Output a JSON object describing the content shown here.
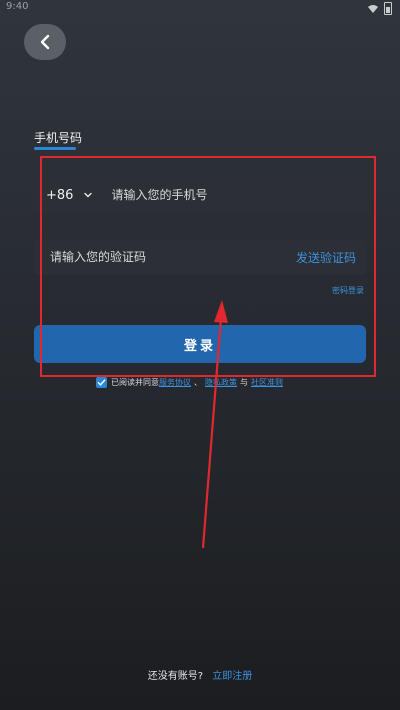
{
  "status_bar": {
    "time": "9:40",
    "icons": [
      "wifi-icon",
      "battery-icon"
    ]
  },
  "header": {
    "back_icon": "chevron-left-icon"
  },
  "login_tab": {
    "label": "手机号码"
  },
  "form": {
    "country_code": "+86",
    "phone_placeholder": "请输入您的手机号",
    "code_placeholder": "请输入您的验证码",
    "send_code_label": "发送验证码",
    "password_login_label": "密码登录",
    "login_button_label": "登录"
  },
  "agreement": {
    "checked": true,
    "prefix": "已阅读并同意",
    "terms_label": "服务协议",
    "separator": "、",
    "privacy_label": "隐私政策",
    "conjunction": "与",
    "community_label": "社区准则"
  },
  "footer": {
    "prompt": "还没有账号?",
    "register_label": "立即注册"
  },
  "colors": {
    "accent": "#2b86d6",
    "link": "#3c93e0",
    "button": "#2266ad",
    "annotation": "#e0282e"
  }
}
